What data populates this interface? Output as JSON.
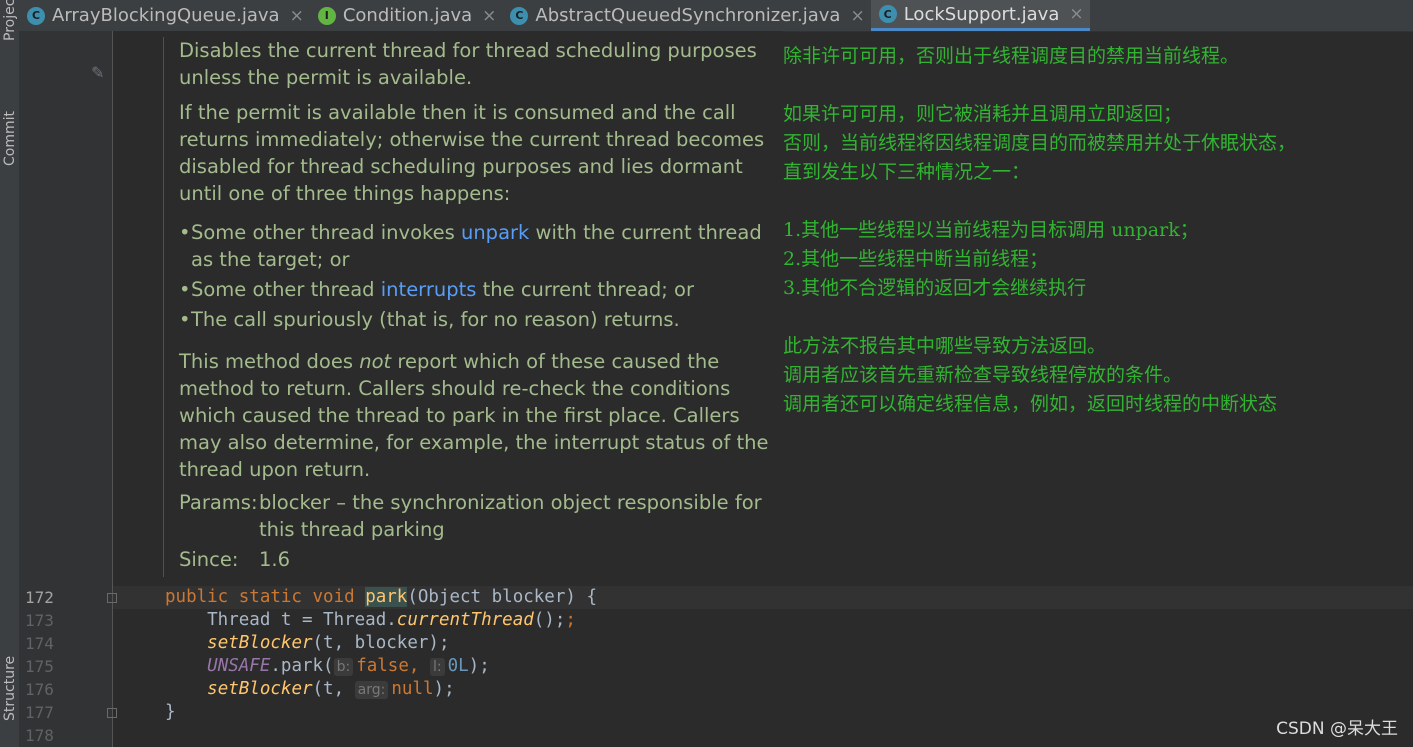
{
  "sidebar": {
    "project_label": "Project",
    "commit_label": "Commit",
    "structure_label": "Structure"
  },
  "tabs": [
    {
      "name": "ArrayBlockingQueue.java",
      "icon": "class-icon",
      "icon_letter": "C",
      "active": false
    },
    {
      "name": "Condition.java",
      "icon": "interface-icon",
      "icon_letter": "I",
      "active": false
    },
    {
      "name": "AbstractQueuedSynchronizer.java",
      "icon": "class-icon",
      "icon_letter": "C",
      "active": false
    },
    {
      "name": "LockSupport.java",
      "icon": "class-icon",
      "icon_letter": "C",
      "active": true
    }
  ],
  "tab_close_glyph": "×",
  "javadoc": {
    "p1": "Disables the current thread for thread scheduling purposes unless the permit is available.",
    "p2": "If the permit is available then it is consumed and the call returns immediately; otherwise the current thread becomes disabled for thread scheduling purposes and lies dormant until one of three things happens:",
    "bullet1_pre": "Some other thread invokes ",
    "bullet1_link": "unpark",
    "bullet1_post": " with the current thread as the target; or",
    "bullet2_pre": "Some other thread ",
    "bullet2_link": "interrupts",
    "bullet2_post": " the current thread; or",
    "bullet3": "The call spuriously (that is, for no reason) returns.",
    "p3_pre": "This method does ",
    "p3_em": "not",
    "p3_post": " report which of these caused the method to return. Callers should re-check the conditions which caused the thread to park in the first place. Callers may also determine, for example, the interrupt status of the thread upon return.",
    "params_label": "Params:",
    "params_text": "blocker – the synchronization object responsible for this thread parking",
    "since_label": "Since:",
    "since_value": "1.6"
  },
  "translation": [
    "除非许可可用，否则出于线程调度目的禁用当前线程。",
    "",
    "如果许可可用，则它被消耗并且调用立即返回；",
    "否则，当前线程将因线程调度目的而被禁用并处于休眠状态，",
    "直到发生以下三种情况之一：",
    "",
    "1.其他一些线程以当前线程为目标调用 unpark；",
    "2.其他一些线程中断当前线程；",
    "3.其他不合逻辑的返回才会继续执行",
    "",
    "此方法不报告其中哪些导致方法返回。",
    "调用者应该首先重新检查导致线程停放的条件。",
    "调用者还可以确定线程信息，例如，返回时线程的中断状态"
  ],
  "line_numbers": [
    "172",
    "173",
    "174",
    "175",
    "176",
    "177",
    "178"
  ],
  "code": {
    "l172_kw": "public static void ",
    "l172_method": "park",
    "l172_rest": "(Object blocker) {",
    "l173_pre": "    Thread t = Thread.",
    "l173_call": "currentThread",
    "l173_post": "();",
    "l174_call": "setBlocker",
    "l174_post": "(t, blocker);",
    "l175_field": "UNSAFE",
    "l175_mid": ".park(",
    "l175_hint1": "b:",
    "l175_kw": "false",
    "l175_comma": ", ",
    "l175_hint2": "l:",
    "l175_num": "0L",
    "l175_end": ");",
    "l176_call": "setBlocker",
    "l176_mid": "(t, ",
    "l176_hint": "arg:",
    "l176_kw": "null",
    "l176_end": ");",
    "l177": "}"
  },
  "watermark": "CSDN @呆大王",
  "colors": {
    "doc_text": "#a3bb8d",
    "link": "#589df6",
    "translation": "#32b432",
    "keyword": "#cc7832",
    "active_tab_underline": "#4a88c7"
  }
}
